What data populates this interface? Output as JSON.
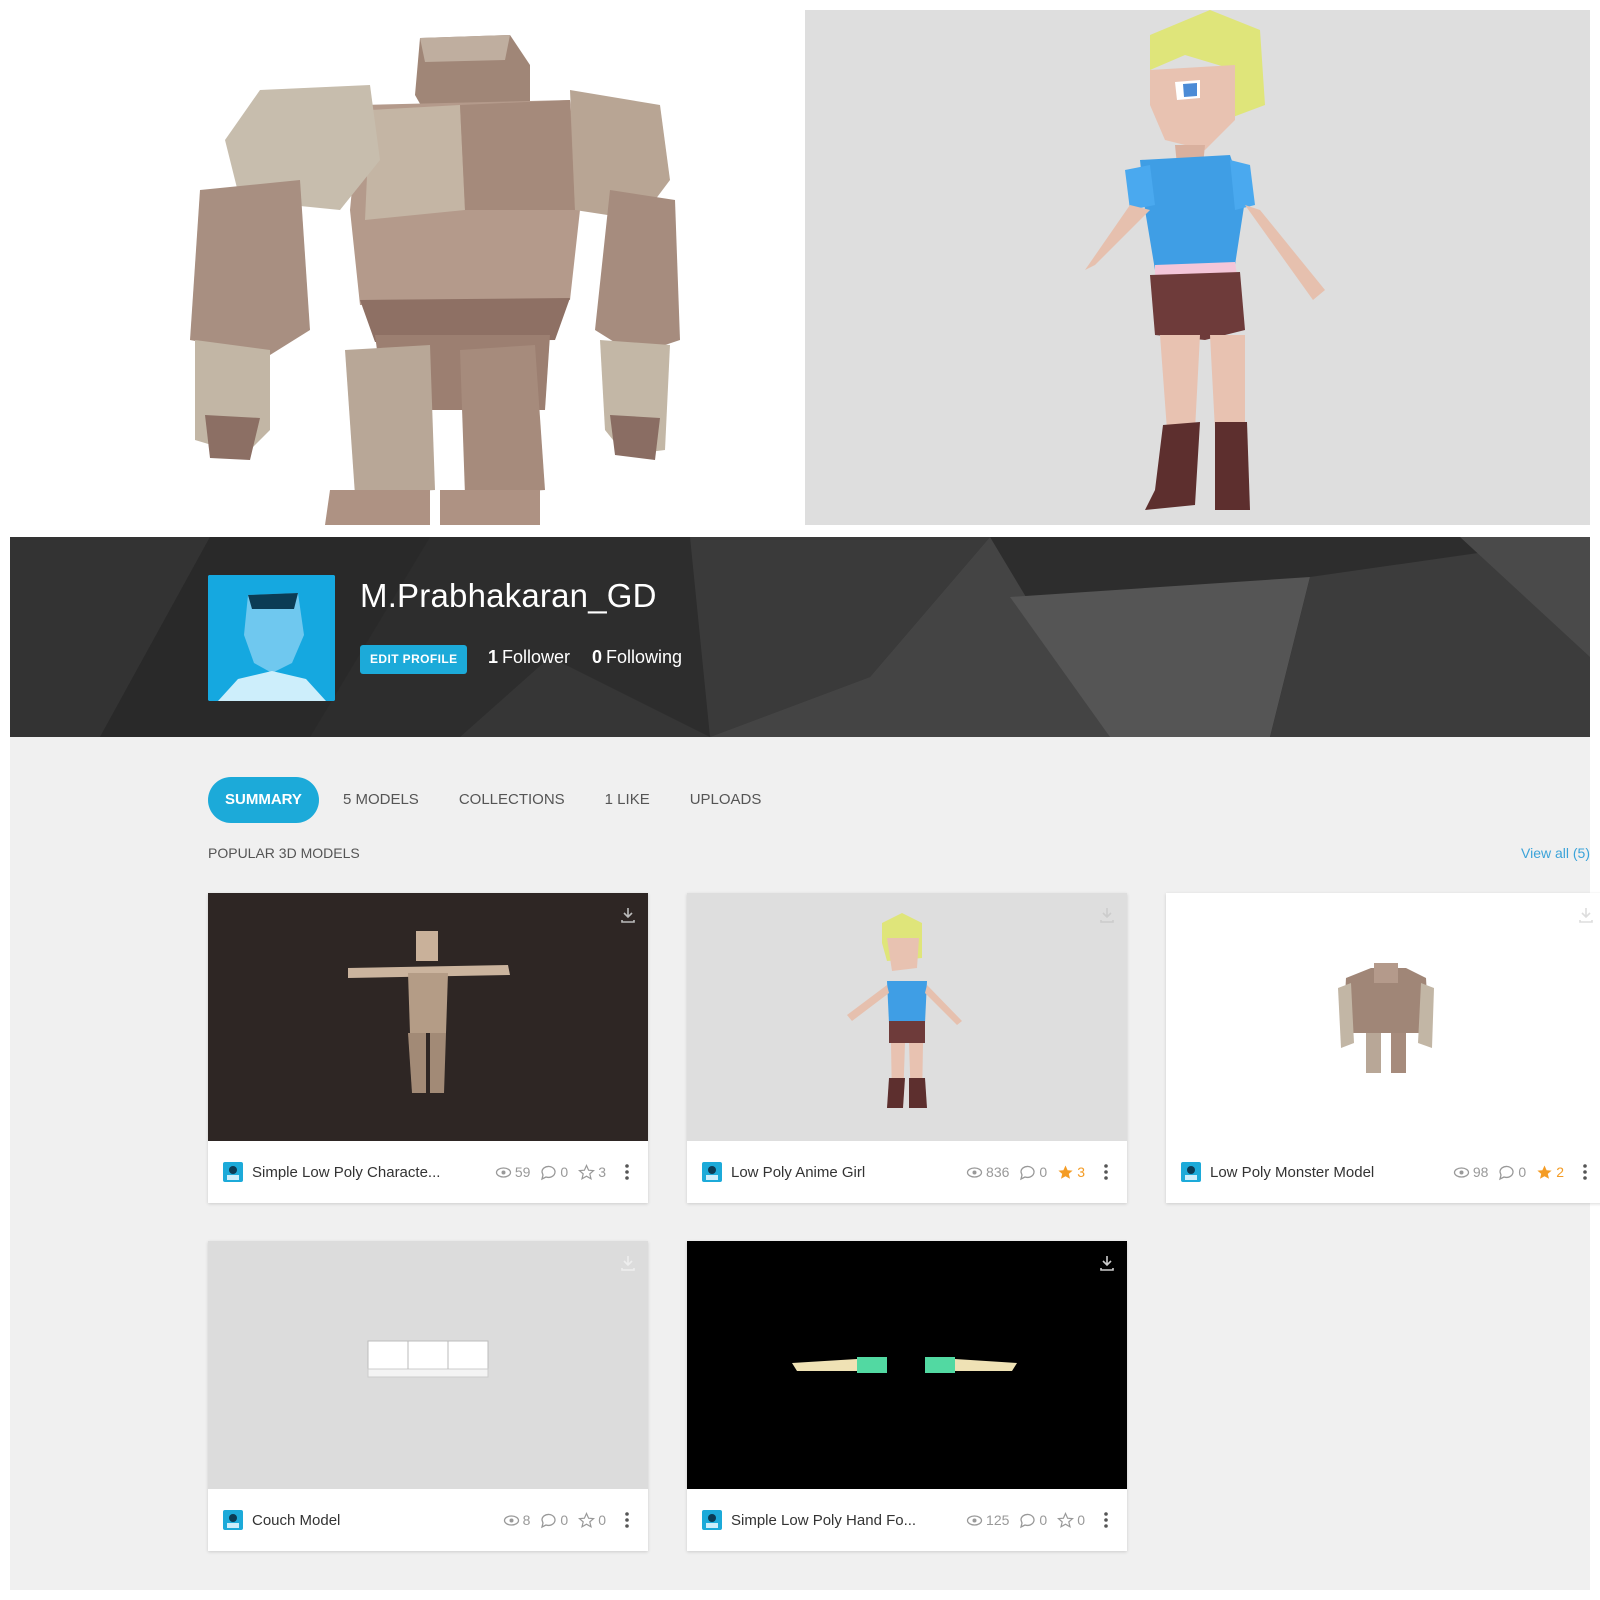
{
  "profile": {
    "username": "M.Prabhakaran_GD",
    "edit_label": "EDIT PROFILE",
    "followers_count": "1",
    "followers_label": "Follower",
    "following_count": "0",
    "following_label": "Following"
  },
  "tabs": [
    {
      "label": "SUMMARY",
      "active": true
    },
    {
      "label": "5 MODELS",
      "active": false
    },
    {
      "label": "COLLECTIONS",
      "active": false
    },
    {
      "label": "1 LIKE",
      "active": false
    },
    {
      "label": "UPLOADS",
      "active": false
    }
  ],
  "section": {
    "title": "POPULAR 3D MODELS",
    "view_all": "View all (5)"
  },
  "models": [
    {
      "title": "Simple Low Poly Characte...",
      "views": "59",
      "comments": "0",
      "likes": "3",
      "liked": false,
      "bg": "#2e2624"
    },
    {
      "title": "Low Poly Anime Girl",
      "views": "836",
      "comments": "0",
      "likes": "3",
      "liked": true,
      "bg": "#dedede"
    },
    {
      "title": "Low Poly Monster Model",
      "views": "98",
      "comments": "0",
      "likes": "2",
      "liked": true,
      "bg": "#ffffff"
    },
    {
      "title": "Couch Model",
      "views": "8",
      "comments": "0",
      "likes": "0",
      "liked": false,
      "bg": "#dcdcdc"
    },
    {
      "title": "Simple Low Poly Hand Fo...",
      "views": "125",
      "comments": "0",
      "likes": "0",
      "liked": false,
      "bg": "#000000"
    }
  ],
  "colors": {
    "accent": "#1caad9",
    "banner": "#2c2c2c",
    "like_active": "#f49c25"
  }
}
